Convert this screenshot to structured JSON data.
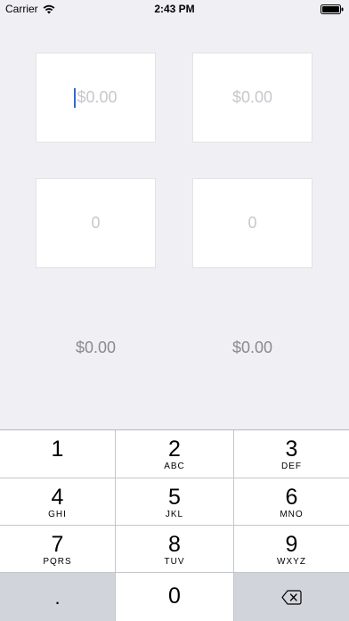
{
  "status_bar": {
    "carrier": "Carrier",
    "time": "2:43 PM"
  },
  "fields": {
    "top_left_placeholder": "$0.00",
    "top_right_placeholder": "$0.00",
    "mid_left_placeholder": "0",
    "mid_right_placeholder": "0"
  },
  "results": {
    "left": "$0.00",
    "right": "$0.00"
  },
  "keypad": {
    "keys": [
      {
        "num": "1",
        "letters": ""
      },
      {
        "num": "2",
        "letters": "ABC"
      },
      {
        "num": "3",
        "letters": "DEF"
      },
      {
        "num": "4",
        "letters": "GHI"
      },
      {
        "num": "5",
        "letters": "JKL"
      },
      {
        "num": "6",
        "letters": "MNO"
      },
      {
        "num": "7",
        "letters": "PQRS"
      },
      {
        "num": "8",
        "letters": "TUV"
      },
      {
        "num": "9",
        "letters": "WXYZ"
      }
    ],
    "dot": ".",
    "zero": "0",
    "backspace_icon": "backspace-icon"
  }
}
